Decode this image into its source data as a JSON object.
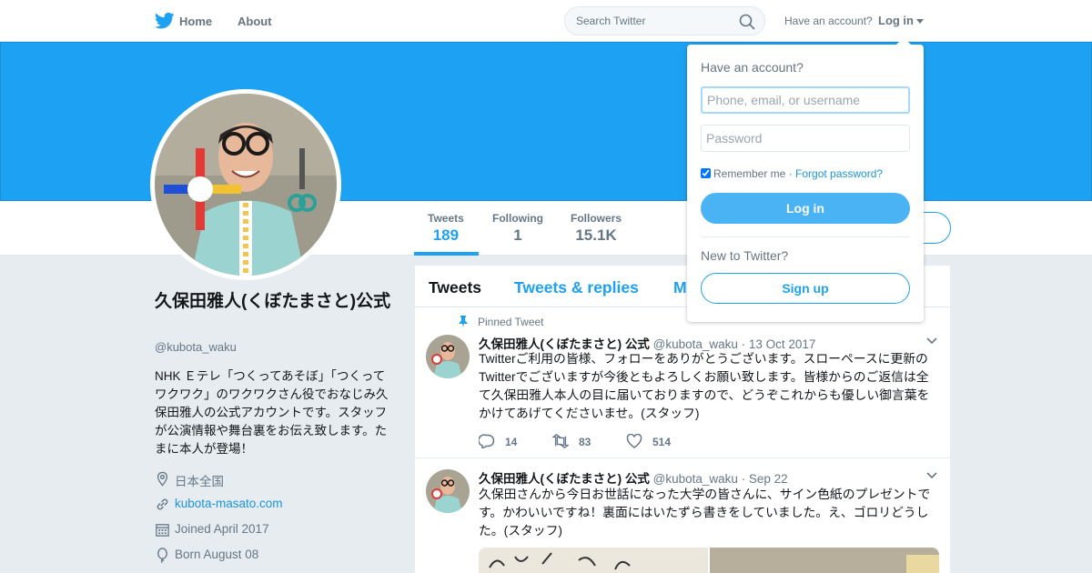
{
  "nav": {
    "home": "Home",
    "about": "About",
    "search_placeholder": "Search Twitter",
    "have_account": "Have an account?",
    "login": "Log in"
  },
  "profile": {
    "name": "久保田雅人(くぼたまさと)公式",
    "handle": "@kubota_waku",
    "bio": "NHK Ｅテレ「つくってあそぼ」「つくってワクワク」のワクワクさん役でおなじみ久保田雅人の公式アカウントです。スタッフが公演情報や舞台裏をお伝え致します。たまに本人が登場！",
    "location": "日本全国",
    "website": "kubota-masato.com",
    "joined": "Joined April 2017",
    "born": "Born August 08"
  },
  "stats": [
    {
      "label": "Tweets",
      "value": "189"
    },
    {
      "label": "Following",
      "value": "1"
    },
    {
      "label": "Followers",
      "value": "15.1K"
    }
  ],
  "timeline_tabs": [
    "Tweets",
    "Tweets & replies",
    "M"
  ],
  "tweets": [
    {
      "pinned_label": "Pinned Tweet",
      "name": "久保田雅人(くぼたまさと) 公式",
      "handle": "@kubota_waku",
      "date": "· 13 Oct 2017",
      "text": "Twitterご利用の皆様、フォローをありがとうございます。スローペースに更新のTwitterでございますが今後ともよろしくお願い致します。皆様からのご返信は全て久保田雅人本人の目に届いておりますので、どうぞこれからも優しい御言葉をかけてあげてくださいませ。(スタッフ)",
      "replies": "14",
      "retweets": "83",
      "likes": "514"
    },
    {
      "name": "久保田雅人(くぼたまさと) 公式",
      "handle": "@kubota_waku",
      "date": "· Sep 22",
      "text": "久保田さんから今日お世話になった大学の皆さんに、サイン色紙のプレゼントです。かわいいですね！裏面にはいたずら書きをしていました。え、ゴロリどうした。(スタッフ)"
    }
  ],
  "login_dropdown": {
    "title": "Have an account?",
    "username_placeholder": "Phone, email, or username",
    "password_placeholder": "Password",
    "remember": "Remember me",
    "separator": " · ",
    "forgot": "Forgot password?",
    "login_button": "Log in",
    "new_to": "New to Twitter?",
    "signup_button": "Sign up"
  },
  "colors": {
    "accent": "#1da1f2",
    "banner": "#1da1f2",
    "background": "#e6ecf0"
  },
  "icons": [
    "twitter-bird-icon",
    "search-icon",
    "caret-down-icon",
    "location-icon",
    "link-icon",
    "calendar-icon",
    "balloon-icon",
    "pin-icon",
    "reply-icon",
    "retweet-icon",
    "heart-icon",
    "chevron-down-icon"
  ]
}
